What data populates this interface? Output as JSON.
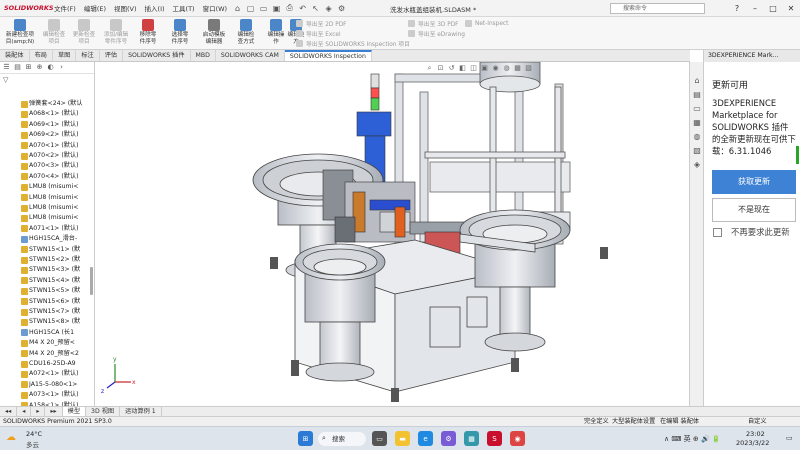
{
  "app": {
    "logo": "SOLIDWORKS",
    "document_title": "洗发水瓶盖组装机.SLDASM *",
    "menus": [
      "文件(F)",
      "编辑(E)",
      "视图(V)",
      "插入(I)",
      "工具(T)",
      "窗口(W)"
    ],
    "search_placeholder": "搜索命令",
    "window_controls": [
      "?",
      "–",
      "□",
      "✕"
    ]
  },
  "ribbon": {
    "buttons": [
      {
        "label1": "新建检查项",
        "label2": "目(amp;N)",
        "enabled": true,
        "color": "#4a86c8"
      },
      {
        "label1": "编辑检查",
        "label2": "项目",
        "enabled": false,
        "color": "#c8c8c8"
      },
      {
        "label1": "更新检查",
        "label2": "项目",
        "enabled": false,
        "color": "#c8c8c8"
      },
      {
        "label1": "添加/编辑",
        "label2": "零件序号",
        "enabled": false,
        "color": "#c8c8c8"
      },
      {
        "label1": "移除零",
        "label2": "件序号",
        "enabled": true,
        "color": "#d04040"
      },
      {
        "label1": "选择零",
        "label2": "件序号",
        "enabled": true,
        "color": "#4a86c8"
      },
      {
        "label1": "启动模板",
        "label2": "编辑器",
        "enabled": true,
        "color": "#7a7a7a"
      },
      {
        "label1": "编辑检",
        "label2": "查方式",
        "enabled": true,
        "color": "#4a86c8"
      },
      {
        "label1": "编辑操",
        "label2": "作",
        "enabled": true,
        "color": "#4a86c8"
      },
      {
        "label1": "编辑类",
        "label2": "方",
        "enabled": true,
        "color": "#4a86c8"
      }
    ],
    "export_items": [
      "导出至 2D PDF",
      "导出至 Excel",
      "导出至 SOLIDWORKS Inspection 项目",
      "导出至 3D PDF",
      "导出至 eDrawing",
      "Net-Inspect"
    ]
  },
  "command_tabs": [
    "装配体",
    "布局",
    "草图",
    "标注",
    "评估",
    "SOLIDWORKS 插件",
    "MBD",
    "SOLIDWORKS CAM",
    "SOLIDWORKS Inspection"
  ],
  "active_command_tab": "SOLIDWORKS Inspection",
  "tree": {
    "items": [
      {
        "label": "弹簧套<24> (默认",
        "type": "part"
      },
      {
        "label": "A068<1> (默认)",
        "type": "part"
      },
      {
        "label": "A069<1> (默认)",
        "type": "part"
      },
      {
        "label": "A069<2> (默认)",
        "type": "part"
      },
      {
        "label": "A070<1> (默认)",
        "type": "part"
      },
      {
        "label": "A070<2> (默认)",
        "type": "part"
      },
      {
        "label": "A070<3> (默认)",
        "type": "part"
      },
      {
        "label": "A070<4> (默认)",
        "type": "part"
      },
      {
        "label": "LMU8 (misumi<",
        "type": "part"
      },
      {
        "label": "LMU8 (misumi<",
        "type": "part"
      },
      {
        "label": "LMU8 (misumi<",
        "type": "part"
      },
      {
        "label": "LMU8 (misumi<",
        "type": "part"
      },
      {
        "label": "A071<1> (默认)",
        "type": "part"
      },
      {
        "label": "HGH15CA_滑台-",
        "type": "assembly"
      },
      {
        "label": "STWN15<1> (默",
        "type": "part"
      },
      {
        "label": "STWN15<2> (默",
        "type": "part"
      },
      {
        "label": "STWN15<3> (默",
        "type": "part"
      },
      {
        "label": "STWN15<4> (默",
        "type": "part"
      },
      {
        "label": "STWN15<5> (默",
        "type": "part"
      },
      {
        "label": "STWN15<6> (默",
        "type": "part"
      },
      {
        "label": "STWN15<7> (默",
        "type": "part"
      },
      {
        "label": "STWN15<8> (默",
        "type": "part"
      },
      {
        "label": "HGH15CA (长1",
        "type": "assembly"
      },
      {
        "label": "M4 X 20_预留<",
        "type": "part"
      },
      {
        "label": "M4 X 20_预留<2",
        "type": "part"
      },
      {
        "label": "CDU16-25D-A9",
        "type": "part"
      },
      {
        "label": "A072<1> (默认)",
        "type": "part"
      },
      {
        "label": "JA15-5-080<1>",
        "type": "part"
      },
      {
        "label": "A073<1> (默认)",
        "type": "part"
      },
      {
        "label": "A158<1> (默认)",
        "type": "part"
      }
    ]
  },
  "bottom_tabs": [
    "模型",
    "3D 视图",
    "运动算例 1"
  ],
  "status": {
    "left": "SOLIDWORKS Premium 2021 SP3.0",
    "items": [
      "完全定义",
      "大型装配体设置",
      "在编辑 装配体"
    ],
    "right": "自定义"
  },
  "task_pane": {
    "header": "3DEXPERIENCE Mark...",
    "title": "更新可用",
    "body": "3DEXPERIENCE Marketplace for SOLIDWORKS 插件的全新更新现在可供下载：6.31.1046",
    "get_update": "获取更新",
    "not_now": "不是现在",
    "never_remind": "不再要求此更新"
  },
  "taskbar": {
    "weather_temp": "24°C",
    "weather_desc": "多云",
    "search_label": "搜索",
    "tray": "∧  ⌨  英  ⊕  🔊  🔋",
    "time": "23:02",
    "date": "2023/3/22"
  },
  "viewport": {
    "axis_x": "x",
    "axis_y": "y",
    "axis_z": "z"
  }
}
